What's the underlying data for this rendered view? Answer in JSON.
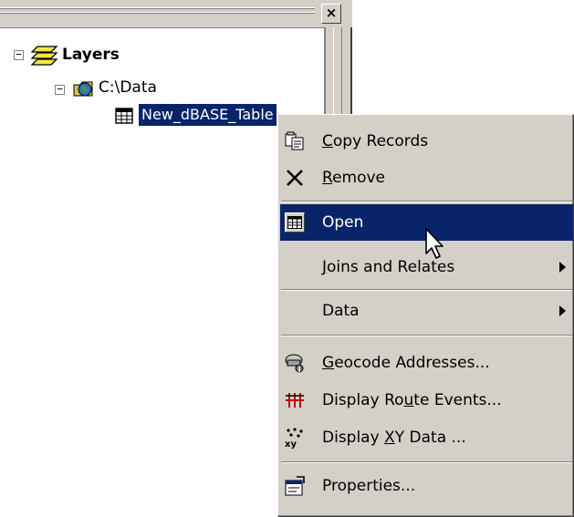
{
  "window": {
    "close_glyph": "×"
  },
  "tree": {
    "root_expander": "−",
    "root_label": "Layers",
    "folder_expander": "−",
    "folder_label": "C:\\Data",
    "selected_table_label": "New_dBASE_Table"
  },
  "context_menu": {
    "items": [
      {
        "label": "Copy Records",
        "accel": "C",
        "icon": "copy-records-icon",
        "submenu": false
      },
      {
        "label": "Remove",
        "accel": "R",
        "icon": "remove-icon",
        "submenu": false
      },
      {
        "label": "Open",
        "accel": "",
        "icon": "open-table-icon",
        "submenu": false,
        "highlighted": true
      },
      {
        "label": "Joins and Relates",
        "accel": "J",
        "icon": "",
        "submenu": true
      },
      {
        "label": "Data",
        "accel": "",
        "icon": "",
        "submenu": true
      },
      {
        "label": "Geocode Addresses...",
        "accel": "G",
        "icon": "geocode-icon",
        "submenu": false
      },
      {
        "label": "Display Route Events...",
        "accel": "u",
        "icon": "route-events-icon",
        "submenu": false
      },
      {
        "label": "Display XY Data ...",
        "accel": "X",
        "icon": "xy-data-icon",
        "submenu": false
      },
      {
        "label": "Properties...",
        "accel": "",
        "icon": "properties-icon",
        "submenu": false
      }
    ]
  },
  "colors": {
    "selection": "#0a246a",
    "menu_face": "#d4d0c8",
    "route_icon": "#c00000"
  }
}
